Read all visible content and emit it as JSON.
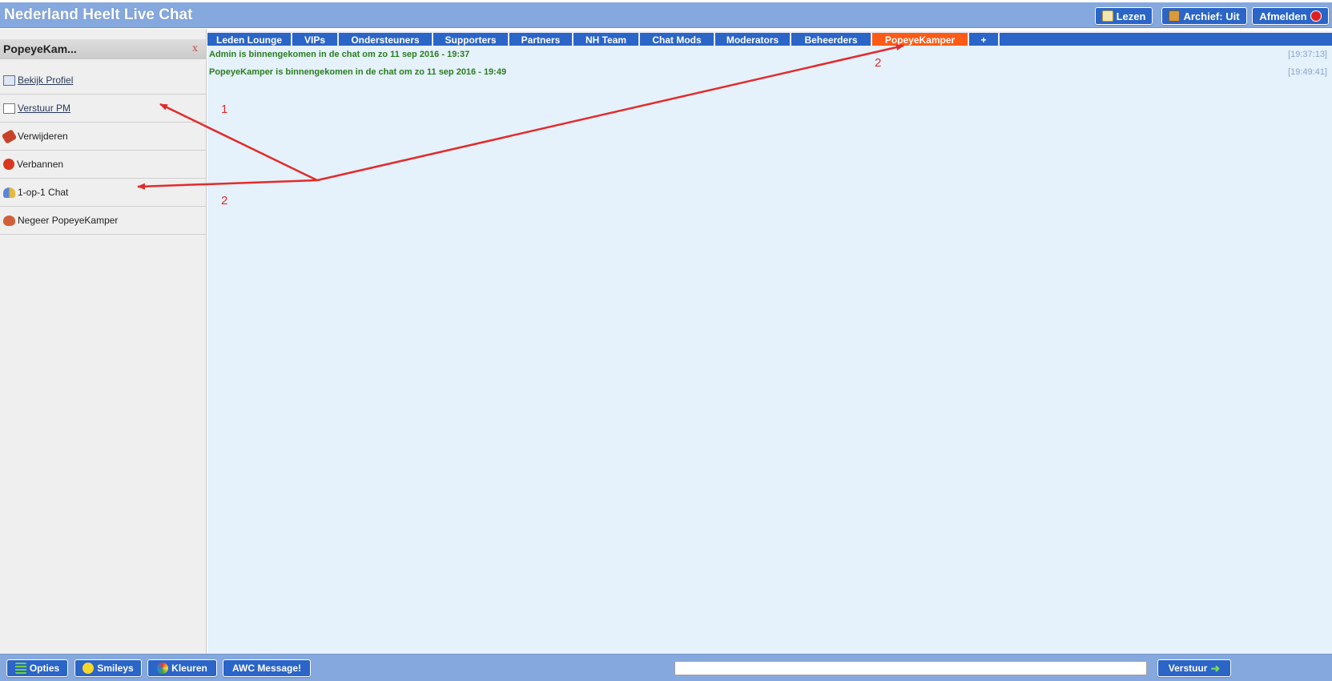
{
  "header": {
    "title": "Nederland Heelt Live Chat",
    "buttons": {
      "read": "Lezen",
      "archive": "Archief: Uit",
      "logout": "Afmelden"
    }
  },
  "sidebar": {
    "user": "PopeyeKam...",
    "close": "x",
    "items": [
      {
        "label": "Bekijk Profiel",
        "icon": "profile-card-icon"
      },
      {
        "label": "Verstuur PM",
        "icon": "envelope-icon"
      },
      {
        "label": "Verwijderen",
        "icon": "kick-icon"
      },
      {
        "label": "Verbannen",
        "icon": "ban-icon"
      },
      {
        "label": "1-op-1 Chat",
        "icon": "users-icon"
      },
      {
        "label": "Negeer PopeyeKamper",
        "icon": "broken-heart-icon"
      }
    ]
  },
  "tabs": [
    {
      "label": "Leden Lounge"
    },
    {
      "label": "VIPs"
    },
    {
      "label": "Ondersteuners"
    },
    {
      "label": "Supporters"
    },
    {
      "label": "Partners"
    },
    {
      "label": "NH Team"
    },
    {
      "label": "Chat Mods"
    },
    {
      "label": "Moderators"
    },
    {
      "label": "Beheerders"
    },
    {
      "label": "PopeyeKamper",
      "active": true
    },
    {
      "label": "+"
    }
  ],
  "messages": [
    {
      "text": "Admin is binnengekomen in de chat om zo 11 sep 2016 - 19:37",
      "time": "[19:37:13]"
    },
    {
      "text": "PopeyeKamper is binnengekomen in de chat om zo 11 sep 2016 - 19:49",
      "time": "[19:49:41]"
    }
  ],
  "annotations": {
    "one": "1",
    "two_left": "2",
    "two_top": "2",
    "color": "#e22b2b"
  },
  "footer": {
    "options": "Opties",
    "smileys": "Smileys",
    "colors": "Kleuren",
    "awc": "AWC Message!",
    "input_value": "",
    "send": "Verstuur"
  },
  "colors": {
    "brand_blue": "#2a65c7",
    "header_blue": "#85a8de",
    "active_tab": "#ff5a16",
    "system_msg": "#2b7d1f"
  }
}
